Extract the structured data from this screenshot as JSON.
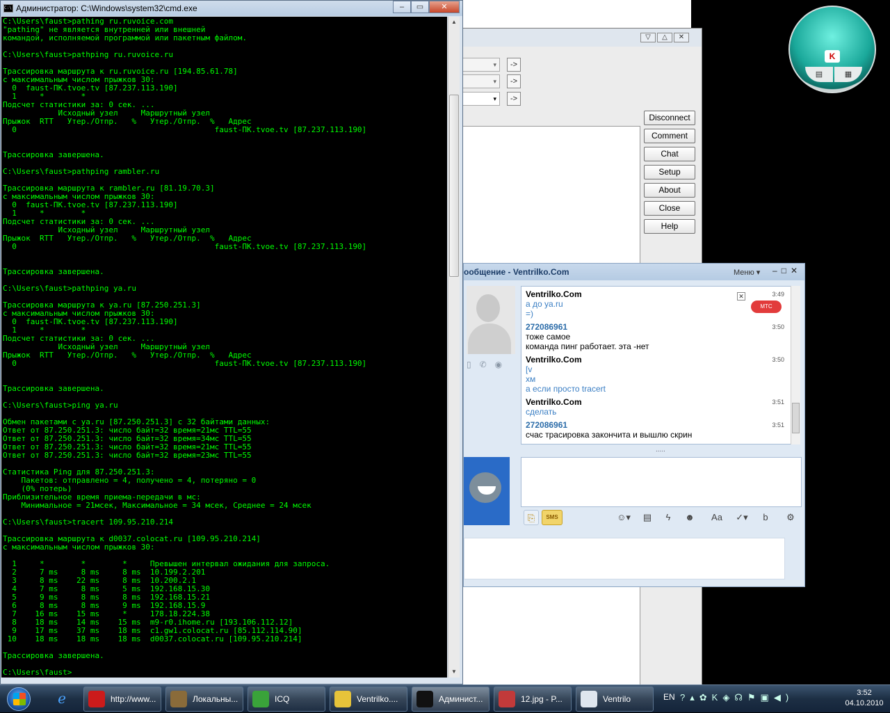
{
  "cmd": {
    "title": "Администратор: C:\\Windows\\system32\\cmd.exe",
    "icon": "C:\\",
    "lines": [
      "C:\\Users\\faust>pathing ru.ruvoice.com",
      "\"pathing\" не является внутренней или внешней",
      "командой, исполняемой программой или пакетным файлом.",
      "",
      "C:\\Users\\faust>pathping ru.ruvoice.ru",
      "",
      "Трассировка маршрута к ru.ruvoice.ru [194.85.61.78]",
      "с максимальным числом прыжков 30:",
      "  0  faust-ПК.tvoe.tv [87.237.113.190]",
      "  1     *        *",
      "Подсчет статистики за: 0 сек. ...",
      "            Исходный узел     Маршрутный узел",
      "Прыжок  RTT   Утер./Отпр.   %   Утер./Отпр.  %   Адрес",
      "  0                                           faust-ПК.tvoe.tv [87.237.113.190]",
      "",
      "",
      "Трассировка завершена.",
      "",
      "C:\\Users\\faust>pathping rambler.ru",
      "",
      "Трассировка маршрута к rambler.ru [81.19.70.3]",
      "с максимальным числом прыжков 30:",
      "  0  faust-ПК.tvoe.tv [87.237.113.190]",
      "  1     *        *",
      "Подсчет статистики за: 0 сек. ...",
      "            Исходный узел     Маршрутный узел",
      "Прыжок  RTT   Утер./Отпр.   %   Утер./Отпр.  %   Адрес",
      "  0                                           faust-ПК.tvoe.tv [87.237.113.190]",
      "",
      "",
      "Трассировка завершена.",
      "",
      "C:\\Users\\faust>pathping ya.ru",
      "",
      "Трассировка маршрута к ya.ru [87.250.251.3]",
      "с максимальным числом прыжков 30:",
      "  0  faust-ПК.tvoe.tv [87.237.113.190]",
      "  1     *        *",
      "Подсчет статистики за: 0 сек. ...",
      "            Исходный узел     Маршрутный узел",
      "Прыжок  RTT   Утер./Отпр.   %   Утер./Отпр.  %   Адрес",
      "  0                                           faust-ПК.tvoe.tv [87.237.113.190]",
      "",
      "",
      "Трассировка завершена.",
      "",
      "C:\\Users\\faust>ping ya.ru",
      "",
      "Обмен пакетами с ya.ru [87.250.251.3] с 32 байтами данных:",
      "Ответ от 87.250.251.3: число байт=32 время=21мс TTL=55",
      "Ответ от 87.250.251.3: число байт=32 время=34мс TTL=55",
      "Ответ от 87.250.251.3: число байт=32 время=21мс TTL=55",
      "Ответ от 87.250.251.3: число байт=32 время=23мс TTL=55",
      "",
      "Статистика Ping для 87.250.251.3:",
      "    Пакетов: отправлено = 4, получено = 4, потеряно = 0",
      "    (0% потерь)",
      "Приблизительное время приема-передачи в мс:",
      "    Минимальное = 21мсек, Максимальное = 34 мсек, Среднее = 24 мсек",
      "",
      "C:\\Users\\faust>tracert 109.95.210.214",
      "",
      "Трассировка маршрута к d0037.colocat.ru [109.95.210.214]",
      "с максимальным числом прыжков 30:",
      "",
      "  1     *        *        *     Превышен интервал ожидания для запроса.",
      "  2     7 ms     8 ms     8 ms  10.199.2.201",
      "  3     8 ms    22 ms     8 ms  10.200.2.1",
      "  4     7 ms     8 ms     5 ms  192.168.15.30",
      "  5     9 ms     8 ms     8 ms  192.168.15.21",
      "  6     8 ms     8 ms     9 ms  192.168.15.9",
      "  7    16 ms    15 ms     *     178.18.224.38",
      "  8    18 ms    14 ms    15 ms  m9-r0.ihome.ru [193.106.112.12]",
      "  9    17 ms    37 ms    18 ms  c1.gw1.colocat.ru [85.112.114.90]",
      " 10    18 ms    18 ms    18 ms  d0037.colocat.ru [109.95.210.214]",
      "",
      "Трассировка завершена.",
      "",
      "C:\\Users\\faust>"
    ]
  },
  "ventrilo": {
    "arrow": "->",
    "buttons": [
      "Disconnect",
      "Comment",
      "Chat",
      "Setup",
      "About",
      "Close",
      "Help"
    ]
  },
  "icq_chat": {
    "title": "ообщение - Ventrilko.Com",
    "menu": "Меню",
    "operator_badge": "МТС",
    "messages": [
      {
        "sender": "Ventrilko.Com",
        "time": "3:49",
        "lines": [
          "а до ya.ru",
          "=)"
        ],
        "mine": false
      },
      {
        "sender": "272086961",
        "time": "3:50",
        "lines": [
          "тоже самое",
          "команда пинг работает. эта -нет"
        ],
        "mine": true
      },
      {
        "sender": "Ventrilko.Com",
        "time": "3:50",
        "lines": [
          "[v",
          "хм",
          "а если просто tracert"
        ],
        "mine": false
      },
      {
        "sender": "Ventrilko.Com",
        "time": "3:51",
        "lines": [
          "сделать"
        ],
        "mine": false
      },
      {
        "sender": "272086961",
        "time": "3:51",
        "lines": [
          "счас трасировка закончита и вышлю скрин"
        ],
        "mine": true
      }
    ],
    "sms_label": "SMS",
    "grip": "....."
  },
  "taskbar": {
    "tasks": [
      {
        "label": "http://www...",
        "icon": "opera-icon"
      },
      {
        "label": "Локальны...",
        "icon": "network-icon"
      },
      {
        "label": "ICQ",
        "icon": "icq-flower-icon"
      },
      {
        "label": "Ventrilko....",
        "icon": "envelope-icon"
      },
      {
        "label": "Админист...",
        "icon": "cmd-icon"
      },
      {
        "label": "12.jpg - P...",
        "icon": "paint-icon"
      },
      {
        "label": "Ventrilo",
        "icon": "headset-icon"
      }
    ],
    "lang": "EN",
    "time": "3:52",
    "date": "04.10.2010"
  },
  "colors": {
    "console_text": "#00ff00",
    "console_bg": "#000000",
    "taskbar": "#1d2f44"
  }
}
